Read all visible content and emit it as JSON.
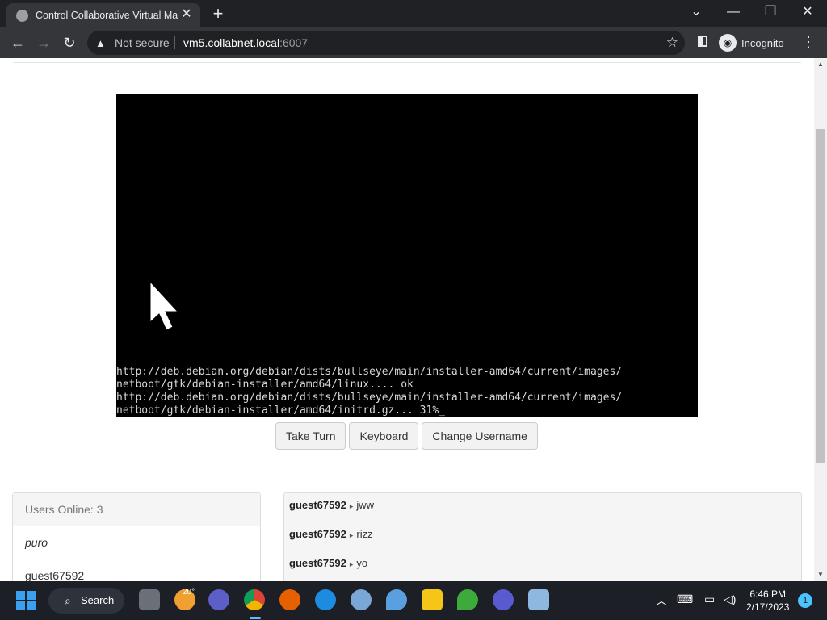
{
  "browser": {
    "tab_title": "Control Collaborative Virtual Machine",
    "new_tab": "+",
    "url_warning": "Not secure",
    "url_host": "vm5.collabnet.local",
    "url_port": ":6007",
    "incognito_label": "Incognito"
  },
  "vm": {
    "console_lines": [
      "http://deb.debian.org/debian/dists/bullseye/main/installer-amd64/current/images/",
      "netboot/gtk/debian-installer/amd64/linux.... ok",
      "http://deb.debian.org/debian/dists/bullseye/main/installer-amd64/current/images/",
      "netboot/gtk/debian-installer/amd64/initrd.gz... 31%_"
    ]
  },
  "controls": {
    "take_turn": "Take Turn",
    "keyboard": "Keyboard",
    "change_username": "Change Username"
  },
  "users": {
    "header": "Users Online: 3",
    "list": [
      "puro",
      "guest67592"
    ]
  },
  "chat": {
    "messages": [
      {
        "user": "guest67592",
        "text": "jww"
      },
      {
        "user": "guest67592",
        "text": "rizz"
      },
      {
        "user": "guest67592",
        "text": "yo"
      }
    ]
  },
  "taskbar": {
    "search_label": "Search",
    "weather_temp": "20°",
    "time": "6:46 PM",
    "date": "2/17/2023",
    "notification_count": "1"
  },
  "colors": {
    "browser_dark": "#202124",
    "toolbar": "#35363a",
    "vm_background": "#000000",
    "taskbar": "#1c1f26"
  }
}
